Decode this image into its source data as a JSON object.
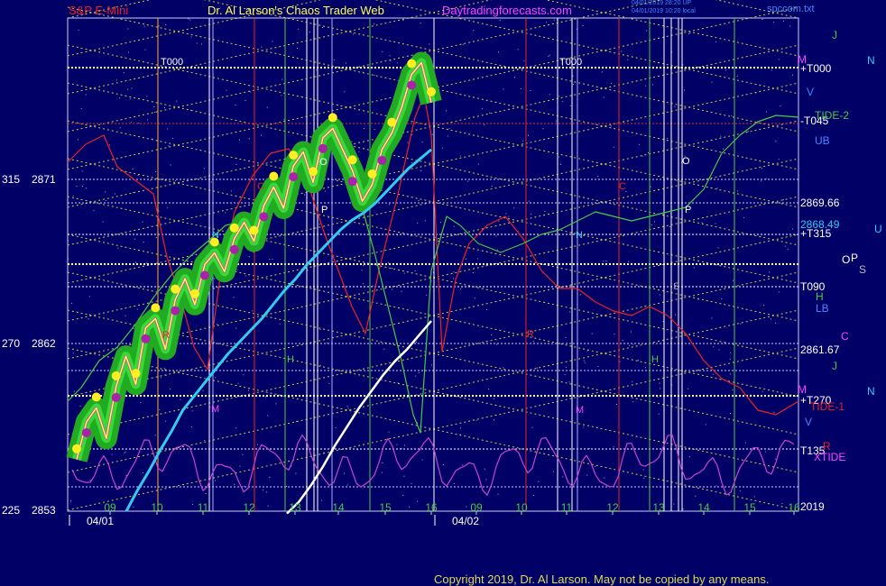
{
  "header": {
    "instrument": "S&P E-Mini",
    "site": "Dr. Al Larson's Chaos Trader Web",
    "url": "Daytradingforecasts.com",
    "timestamp_1": "04/01/2019 28:20 UP",
    "timestamp_2": "04/01/2019 10:20 local",
    "file": "spccom.txt"
  },
  "copyright": "Copyright 2019, Dr. Al Larson. May not be copied by any means.",
  "colors": {
    "background": "#000066",
    "plot_border": "#ccccff",
    "price_glow": "#22aa22",
    "price_line": "#ffff33",
    "trend_line": "#33ccee",
    "white_line": "#ffffff",
    "red_line": "#ee2222",
    "green_line": "#44cc44",
    "oscillator": "#cc44cc"
  },
  "chart_data": {
    "type": "line",
    "title": "S&P E-Mini",
    "y_axis": {
      "ticks": [
        {
          "angle": "315",
          "price": "2871"
        },
        {
          "angle": "270",
          "price": "2862"
        },
        {
          "angle": "225",
          "price": "2853"
        }
      ],
      "ylim": [
        2853,
        2874
      ]
    },
    "x_axis": {
      "hour_labels": [
        "09",
        "10",
        "11",
        "12",
        "13",
        "14",
        "15",
        "16",
        "09",
        "10",
        "11",
        "12",
        "13",
        "14",
        "15",
        "16"
      ],
      "date_labels": [
        "04/01",
        "04/02"
      ]
    },
    "right_levels": [
      {
        "label": "+T000",
        "color": "#ffffff"
      },
      {
        "label": "-T045",
        "color": "#ffffff"
      },
      {
        "label": "2869.66",
        "color": "#ffffff"
      },
      {
        "label": "2868.49",
        "color": "#33ccee"
      },
      {
        "label": "+T315",
        "color": "#ffffff"
      },
      {
        "label": "T090",
        "color": "#ffffff"
      },
      {
        "label": "2861.67",
        "color": "#ffffff"
      },
      {
        "label": "+T270",
        "color": "#ffffff"
      },
      {
        "label": "T135",
        "color": "#ffffff"
      },
      {
        "label": "2019",
        "color": "#ffffff"
      }
    ],
    "right_planets": [
      {
        "label": "J",
        "color": "#44cc44"
      },
      {
        "label": "N",
        "color": "#33ccee"
      },
      {
        "label": "M",
        "color": "#ff44ff"
      },
      {
        "label": "V",
        "color": "#4488ff"
      },
      {
        "label": "TIDE-2",
        "color": "#44cc44"
      },
      {
        "label": "UB",
        "color": "#4488ff"
      },
      {
        "label": "U",
        "color": "#33ccee"
      },
      {
        "label": "O",
        "color": "#ffffff"
      },
      {
        "label": "P",
        "color": "#ffffff"
      },
      {
        "label": "S",
        "color": "#bbbbbb"
      },
      {
        "label": "H",
        "color": "#44cc44"
      },
      {
        "label": "LB",
        "color": "#4488ff"
      },
      {
        "label": "C",
        "color": "#ff44ff"
      },
      {
        "label": "J",
        "color": "#44cc44"
      },
      {
        "label": "M",
        "color": "#ff44ff"
      },
      {
        "label": "N",
        "color": "#33ccee"
      },
      {
        "label": "TIDE-1",
        "color": "#ee2222"
      },
      {
        "label": "V",
        "color": "#4488ff"
      },
      {
        "label": "R",
        "color": "#ee2222"
      },
      {
        "label": "XTIDE",
        "color": "#ff44ff"
      }
    ],
    "top_labels": [
      {
        "label": "T000"
      },
      {
        "label": "T000"
      }
    ],
    "inner_labels": [
      {
        "label": "O",
        "color": "#ffffff"
      },
      {
        "label": "P",
        "color": "#ffffff"
      },
      {
        "label": "N",
        "color": "#33ccee"
      },
      {
        "label": "R",
        "color": "#ee2222"
      },
      {
        "label": "H",
        "color": "#44cc44"
      },
      {
        "label": "M",
        "color": "#ff44ff"
      },
      {
        "label": "C",
        "color": "#ee2222"
      },
      {
        "label": "O",
        "color": "#ffffff"
      },
      {
        "label": "P",
        "color": "#ffffff"
      },
      {
        "label": "N",
        "color": "#33ccee"
      },
      {
        "label": "C",
        "color": "#ee2222"
      },
      {
        "label": "S",
        "color": "#bbbbbb"
      },
      {
        "label": "R",
        "color": "#ee2222"
      },
      {
        "label": "H",
        "color": "#44cc44"
      },
      {
        "label": "M",
        "color": "#ff44ff"
      }
    ],
    "series": [
      {
        "name": "price",
        "color": "#ffff33",
        "values": [
          2855.2,
          2856.8,
          2857.4,
          2856.1,
          2858.3,
          2859.6,
          2858.4,
          2860.8,
          2861.2,
          2859.9,
          2862.0,
          2862.9,
          2861.8,
          2863.5,
          2864.0,
          2863.2,
          2864.6,
          2865.3,
          2864.5,
          2866.0,
          2866.8,
          2865.9,
          2867.7,
          2868.3,
          2867.0,
          2868.9,
          2869.3,
          2868.4,
          2867.5,
          2866.2,
          2866.9,
          2868.4,
          2869.1,
          2870.2,
          2871.6,
          2872.1,
          2870.4
        ]
      },
      {
        "name": "trend",
        "color": "#33ccee",
        "values": [
          2853.0,
          2853.9,
          2854.7,
          2855.6,
          2856.4,
          2857.3,
          2857.9,
          2858.5,
          2859.1,
          2859.7,
          2860.2,
          2860.7,
          2861.2,
          2861.8,
          2862.4,
          2862.9,
          2863.5,
          2864.0,
          2864.5,
          2865.0,
          2865.4,
          2865.7,
          2866.1,
          2866.6,
          2867.1,
          2867.6,
          2868.0,
          2868.4
        ]
      },
      {
        "name": "white",
        "color": "#ffffff",
        "values": [
          2852.9,
          2853.4,
          2854.1,
          2854.9,
          2855.8,
          2856.6,
          2857.4,
          2858.1,
          2858.8,
          2859.4,
          2859.9,
          2860.5,
          2861.1
        ]
      }
    ]
  }
}
